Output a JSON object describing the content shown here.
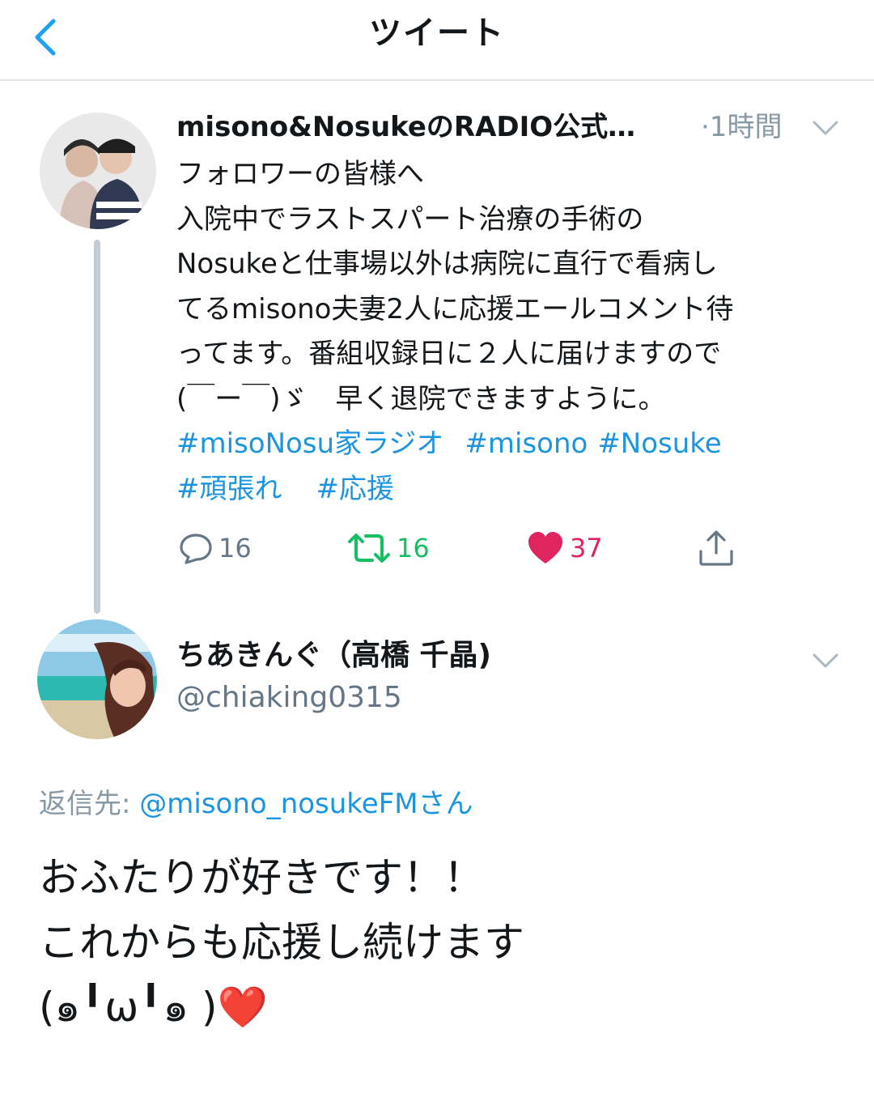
{
  "header": {
    "title": "ツイート"
  },
  "tweet": {
    "author_name": "misono&NosukeのRADIO公式…",
    "time": "·1時間",
    "lines": [
      "フォロワーの皆様へ",
      "入院中でラストスパート治療の手術の",
      "Nosukeと仕事場以外は病院に直行で看病し",
      "てるmisono夫妻2人に応援エールコメント待",
      "ってます。番組収録日に２人に届けますので",
      "(￣ー￣)ゞ　早く退院できますように。"
    ],
    "hashtags_row1": [
      "#misoNosu家ラジオ",
      "#misono",
      "#Nosuke"
    ],
    "hashtags_row2": [
      "#頑張れ",
      "#応援"
    ],
    "actions": {
      "reply_count": "16",
      "retweet_count": "16",
      "like_count": "37"
    }
  },
  "reply": {
    "author_name": "ちあきんぐ（高橋 千晶)",
    "handle": "@chiaking0315",
    "reply_to_label": "返信先: ",
    "reply_to_handle": "@misono_nosukeFMさん",
    "lines": [
      "おふたりが好きです！！",
      "これからも応援し続けます",
      "(๑╹ω╹๑ )❤️"
    ]
  },
  "colors": {
    "link": "#1b95e0",
    "retweet": "#17bf63",
    "like": "#e0245e",
    "muted": "#8899a6"
  }
}
